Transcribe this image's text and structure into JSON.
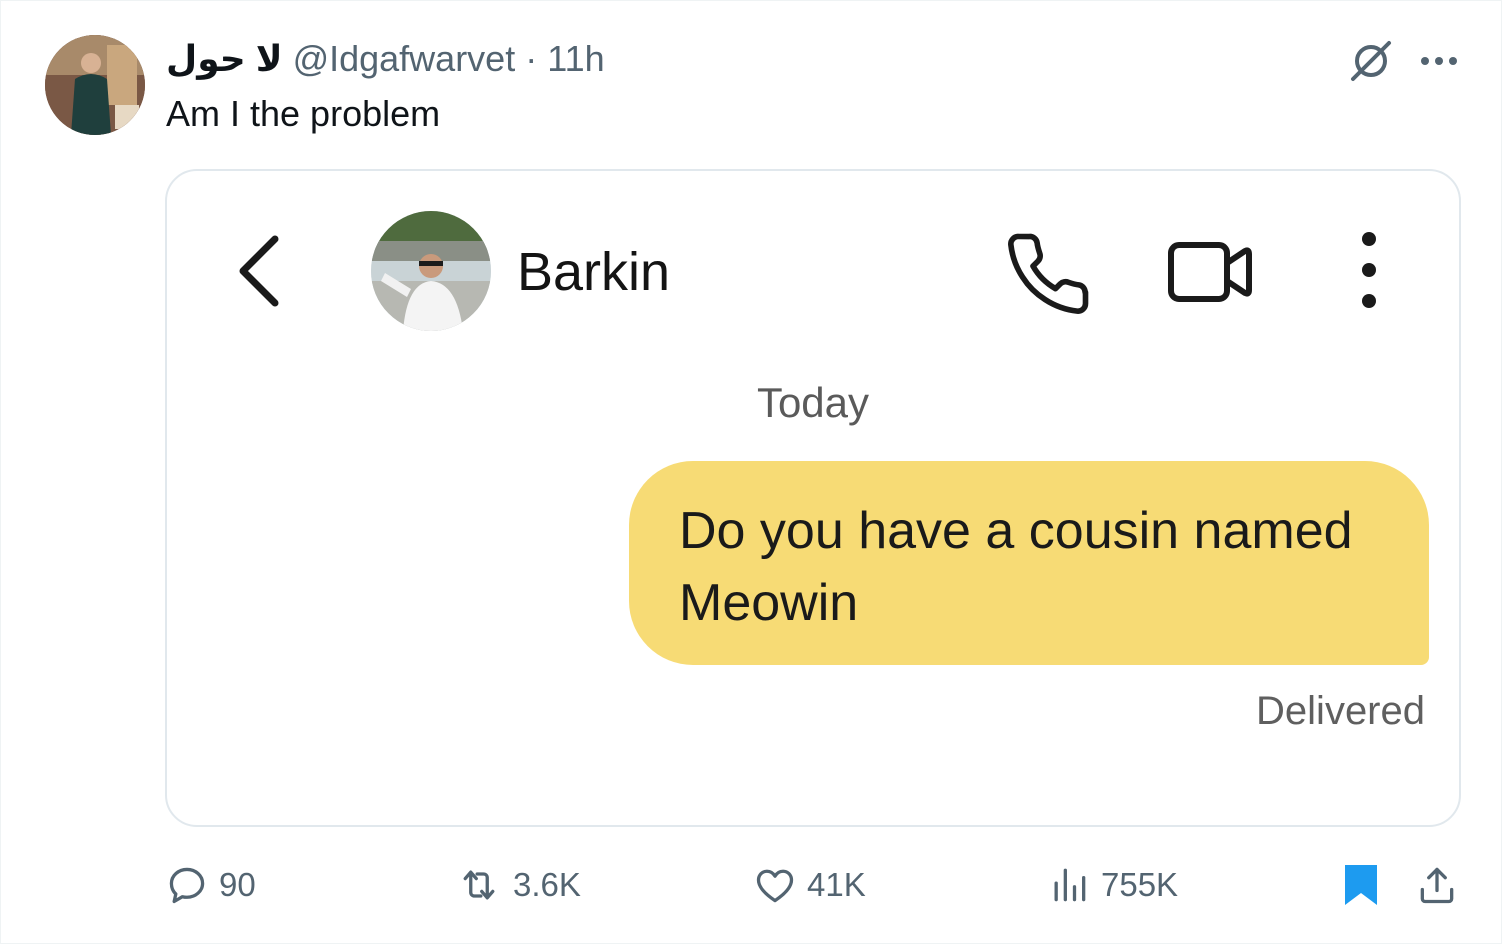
{
  "tweet": {
    "display_name": "لا حول",
    "handle": "@Idgafwarvet",
    "separator": "·",
    "time": "11h",
    "text": "Am I the problem"
  },
  "media": {
    "contact_name": "Barkin",
    "date_label": "Today",
    "message_lines": [
      "Do you have a cousin named",
      "Meowin"
    ],
    "status": "Delivered",
    "bubble_color": "#f7db75"
  },
  "actions": {
    "replies": "90",
    "reposts": "3.6K",
    "likes": "41K",
    "views": "755K"
  },
  "icons": [
    "grok-icon",
    "more-icon",
    "back-arrow-icon",
    "phone-icon",
    "video-camera-icon",
    "vertical-dots-icon",
    "reply-icon",
    "repost-icon",
    "like-icon",
    "views-icon",
    "bookmark-icon",
    "share-icon"
  ],
  "colors": {
    "bookmark_active": "#1d9bf0",
    "secondary_text": "#536471"
  }
}
